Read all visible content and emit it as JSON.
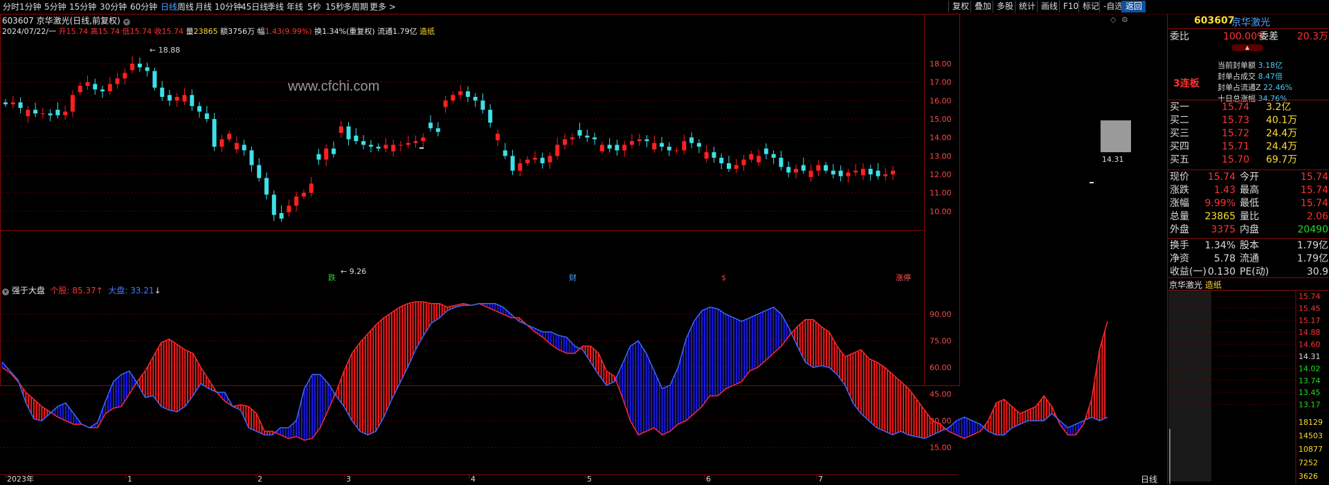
{
  "toolbar": {
    "periods": [
      "分时",
      "1分钟",
      "5分钟",
      "15分钟",
      "30分钟",
      "60分钟",
      "日线",
      "周线",
      "月线",
      "10分钟",
      "45日线",
      "季线",
      "年线",
      "5秒",
      "15秒",
      "多周期",
      "更多 >"
    ],
    "active_period": "日线",
    "right_buttons": [
      "复权",
      "叠加",
      "多股",
      "统计",
      "画线",
      "F10",
      "标记",
      "-自选",
      "返回"
    ],
    "active_right": "返回"
  },
  "header": {
    "stock_title": "603607 京华激光(日线,前复权)",
    "date": "2024/07/22/一",
    "open_label": "开",
    "open": "15.74",
    "high_label": "高",
    "high": "15.74",
    "low_label": "低",
    "low": "15.74",
    "close_label": "收",
    "close": "15.74",
    "vol_label": "量",
    "vol": "23865",
    "amount_label": "额",
    "amount": "3756万",
    "range_label": "幅",
    "range": "1.43(9.99%)",
    "turnover": "换1.34%(重复权)",
    "float": "流通1.79亿",
    "concept": "造纸"
  },
  "watermark": "www.cfchi.com",
  "main_chart": {
    "y_labels": [
      "18.00",
      "17.00",
      "16.00",
      "15.00",
      "14.00",
      "13.00",
      "12.00",
      "11.00",
      "10.00"
    ],
    "y_values": [
      18,
      17,
      16,
      15,
      14,
      13,
      12,
      11,
      10
    ],
    "high_label": "18.88",
    "low_label": "9.26",
    "price_tag": "14.31",
    "markers": [
      {
        "text": "跌",
        "color": "#22dd22",
        "x": 480
      },
      {
        "text": "财",
        "color": "#4aa3ff",
        "x": 828
      },
      {
        "text": "$",
        "color": "#ff3333",
        "x": 1048
      },
      {
        "text": "涨停",
        "color": "#ff5555",
        "x": 1300
      }
    ]
  },
  "chart_data": {
    "type": "candlestick",
    "y_range": [
      9.0,
      19.2
    ],
    "candles_close_approx": [
      15.8,
      15.9,
      15.6,
      15.5,
      15.3,
      15.3,
      15.2,
      15.2,
      15.4,
      16.3,
      16.8,
      17.0,
      16.6,
      16.5,
      16.9,
      17.2,
      17.5,
      18.0,
      17.8,
      17.6,
      16.7,
      16.2,
      16.0,
      16.2,
      16.3,
      15.7,
      15.4,
      15.0,
      13.5,
      13.9,
      14.2,
      13.7,
      13.3,
      12.5,
      11.8,
      10.9,
      9.8,
      9.6,
      10.3,
      10.8,
      11.0,
      11.5,
      12.8,
      13.4,
      13.1,
      14.6,
      13.9,
      13.8,
      13.6,
      13.5,
      13.4,
      13.6,
      13.6,
      13.6,
      13.7,
      13.8,
      14.0,
      14.5,
      14.3,
      16.0,
      16.3,
      16.5,
      16.2,
      16.0,
      15.5,
      14.8,
      14.2,
      13.0,
      12.2,
      12.6,
      12.8,
      12.9,
      12.6,
      13.0,
      13.6,
      13.9,
      14.0,
      14.1,
      14.0,
      13.9,
      13.6,
      13.4,
      13.3,
      13.6,
      13.8,
      13.9,
      13.8,
      13.7,
      13.5,
      13.3,
      13.3,
      13.8,
      13.7,
      13.5,
      13.2,
      12.9,
      12.6,
      12.3,
      12.5,
      12.8,
      13.1,
      13.0,
      13.1,
      12.9,
      12.4,
      12.1,
      12.3,
      12.2,
      12.2,
      12.5,
      12.2,
      12.0,
      11.9,
      12.1,
      12.2,
      12.3,
      12.0,
      11.9,
      12.0,
      12.2
    ],
    "high": 18.88,
    "low": 9.26
  },
  "indicator": {
    "name": "强于大盘",
    "stock_label": "个股:",
    "stock_value": "85.37",
    "stock_arrow": "↑",
    "market_label": "大盘:",
    "market_value": "33.21",
    "market_arrow": "↓",
    "y_labels": [
      "90.00",
      "75.00",
      "60.00",
      "45.00",
      "30.00",
      "15.00"
    ],
    "y_values": [
      90,
      75,
      60,
      45,
      30,
      15
    ],
    "x_labels": [
      "2023年",
      "1",
      "2",
      "3",
      "4",
      "5",
      "6",
      "7"
    ],
    "x_positions": [
      8,
      182,
      370,
      498,
      678,
      846,
      1018,
      1180
    ],
    "bottom_right": "日线",
    "series_stock": [
      60,
      57,
      52,
      46,
      42,
      38,
      35,
      32,
      30,
      28,
      28,
      26,
      26,
      34,
      37,
      38,
      45,
      52,
      58,
      66,
      74,
      76,
      73,
      70,
      68,
      60,
      53,
      46,
      41,
      38,
      39,
      38,
      34,
      24,
      24,
      22,
      20,
      21,
      19,
      20,
      26,
      36,
      46,
      58,
      68,
      74,
      79,
      84,
      88,
      91,
      94,
      96,
      97,
      97,
      96,
      96,
      94,
      95,
      96,
      95,
      96,
      94,
      92,
      90,
      88,
      88,
      84,
      80,
      77,
      73,
      70,
      68,
      68,
      72,
      72,
      68,
      58,
      55,
      43,
      30,
      22,
      24,
      26,
      22,
      24,
      28,
      30,
      34,
      38,
      44,
      44,
      48,
      50,
      52,
      58,
      60,
      64,
      68,
      72,
      78,
      83,
      87,
      87,
      83,
      80,
      72,
      66,
      68,
      70,
      65,
      63,
      60,
      56,
      52,
      48,
      42,
      36,
      30,
      28,
      24,
      22,
      20,
      22,
      24,
      30,
      40,
      42,
      38,
      34,
      36,
      38,
      44,
      38,
      28,
      22,
      22,
      28,
      42,
      70,
      86
    ],
    "series_market": [
      63,
      58,
      53,
      40,
      31,
      30,
      34,
      38,
      40,
      34,
      28,
      26,
      29,
      41,
      52,
      56,
      58,
      51,
      43,
      44,
      38,
      36,
      35,
      38,
      44,
      51,
      48,
      46,
      46,
      38,
      36,
      26,
      24,
      22,
      22,
      26,
      26,
      30,
      48,
      56,
      56,
      51,
      44,
      38,
      30,
      24,
      22,
      24,
      32,
      42,
      51,
      60,
      70,
      78,
      85,
      88,
      92,
      94,
      95,
      95,
      96,
      96,
      96,
      94,
      90,
      86,
      84,
      82,
      80,
      80,
      78,
      77,
      72,
      70,
      63,
      56,
      50,
      52,
      62,
      72,
      75,
      68,
      58,
      48,
      50,
      60,
      76,
      86,
      92,
      94,
      93,
      90,
      88,
      86,
      88,
      90,
      92,
      94,
      90,
      82,
      72,
      63,
      60,
      61,
      60,
      56,
      50,
      40,
      34,
      30,
      26,
      24,
      22,
      24,
      22,
      21,
      20,
      22,
      24,
      26,
      30,
      32,
      30,
      28,
      24,
      22,
      22,
      26,
      28,
      30,
      30,
      30,
      34,
      30,
      26,
      28,
      30,
      32,
      30,
      32,
      34,
      33
    ]
  },
  "right_panel": {
    "code": "603607",
    "name": "京华激光",
    "weibi_label": "委比",
    "weibi": "100.00%",
    "weicha_label": "委差",
    "weicha": "20.3万",
    "lianban": "3连板",
    "seal_lines": [
      {
        "label": "当前封单额",
        "value": "3.18亿"
      },
      {
        "label": "封单占成交",
        "value": "8.47倍"
      },
      {
        "label": "封单占流通Z",
        "value": "22.46%"
      },
      {
        "label": "十日总涨幅",
        "value": "34.76%"
      }
    ],
    "bids": [
      {
        "label": "买一",
        "price": "15.74",
        "vol": "3.2亿"
      },
      {
        "label": "买二",
        "price": "15.73",
        "vol": "40.1万"
      },
      {
        "label": "买三",
        "price": "15.72",
        "vol": "24.4万"
      },
      {
        "label": "买四",
        "price": "15.71",
        "vol": "24.4万"
      },
      {
        "label": "买五",
        "price": "15.70",
        "vol": "69.7万"
      }
    ],
    "quotes": [
      {
        "l1": "现价",
        "v1": "15.74",
        "l2": "今开",
        "v2": "15.74"
      },
      {
        "l1": "涨跌",
        "v1": "1.43",
        "l2": "最高",
        "v2": "15.74"
      },
      {
        "l1": "涨幅",
        "v1": "9.99%",
        "l2": "最低",
        "v2": "15.74"
      },
      {
        "l1": "总量",
        "v1": "23865",
        "l2": "量比",
        "v2": "2.06"
      },
      {
        "l1": "外盘",
        "v1": "3375",
        "l2": "内盘",
        "v2": "20490"
      }
    ],
    "stats": [
      {
        "l1": "换手",
        "v1": "1.34%",
        "l2": "股本",
        "v2": "1.79亿"
      },
      {
        "l1": "净资",
        "v1": "5.78",
        "l2": "流通",
        "v2": "1.79亿"
      },
      {
        "l1": "收益(一)",
        "v1": "0.130",
        "l2": "PE(动)",
        "v2": "30.9"
      }
    ],
    "mini_title": "京华激光",
    "mini_concept": "造纸",
    "mini_prices": [
      "15.74",
      "15.45",
      "15.17",
      "14.88",
      "14.60",
      "14.31",
      "14.02",
      "13.74",
      "13.45",
      "13.17"
    ],
    "mini_vols": [
      "18129",
      "14503",
      "10877",
      "7252",
      "3626"
    ]
  },
  "colors": {
    "up": "#ff2020",
    "down": "#3de0e8",
    "frame": "#8a0a0a",
    "stock_line": "#ff2020",
    "market_line": "#2a2aee"
  }
}
